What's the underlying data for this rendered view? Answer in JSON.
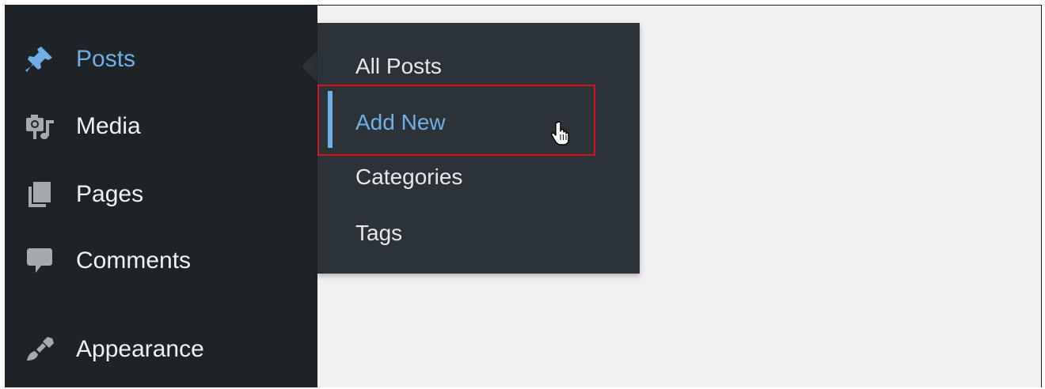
{
  "sidebar": {
    "items": [
      {
        "label": "Posts",
        "icon": "pin-icon",
        "active": true
      },
      {
        "label": "Media",
        "icon": "media-icon"
      },
      {
        "label": "Pages",
        "icon": "pages-icon"
      },
      {
        "label": "Comments",
        "icon": "comment-icon"
      },
      {
        "label": "Appearance",
        "icon": "brush-icon"
      }
    ]
  },
  "submenu": {
    "items": [
      {
        "label": "All Posts"
      },
      {
        "label": "Add New",
        "current": true
      },
      {
        "label": "Categories"
      },
      {
        "label": "Tags"
      }
    ]
  },
  "colors": {
    "sidebar_bg": "#1d2327",
    "submenu_bg": "#2c3338",
    "accent": "#72aee6",
    "highlight_border": "#d8111a",
    "content_bg": "#f0f0f1"
  }
}
